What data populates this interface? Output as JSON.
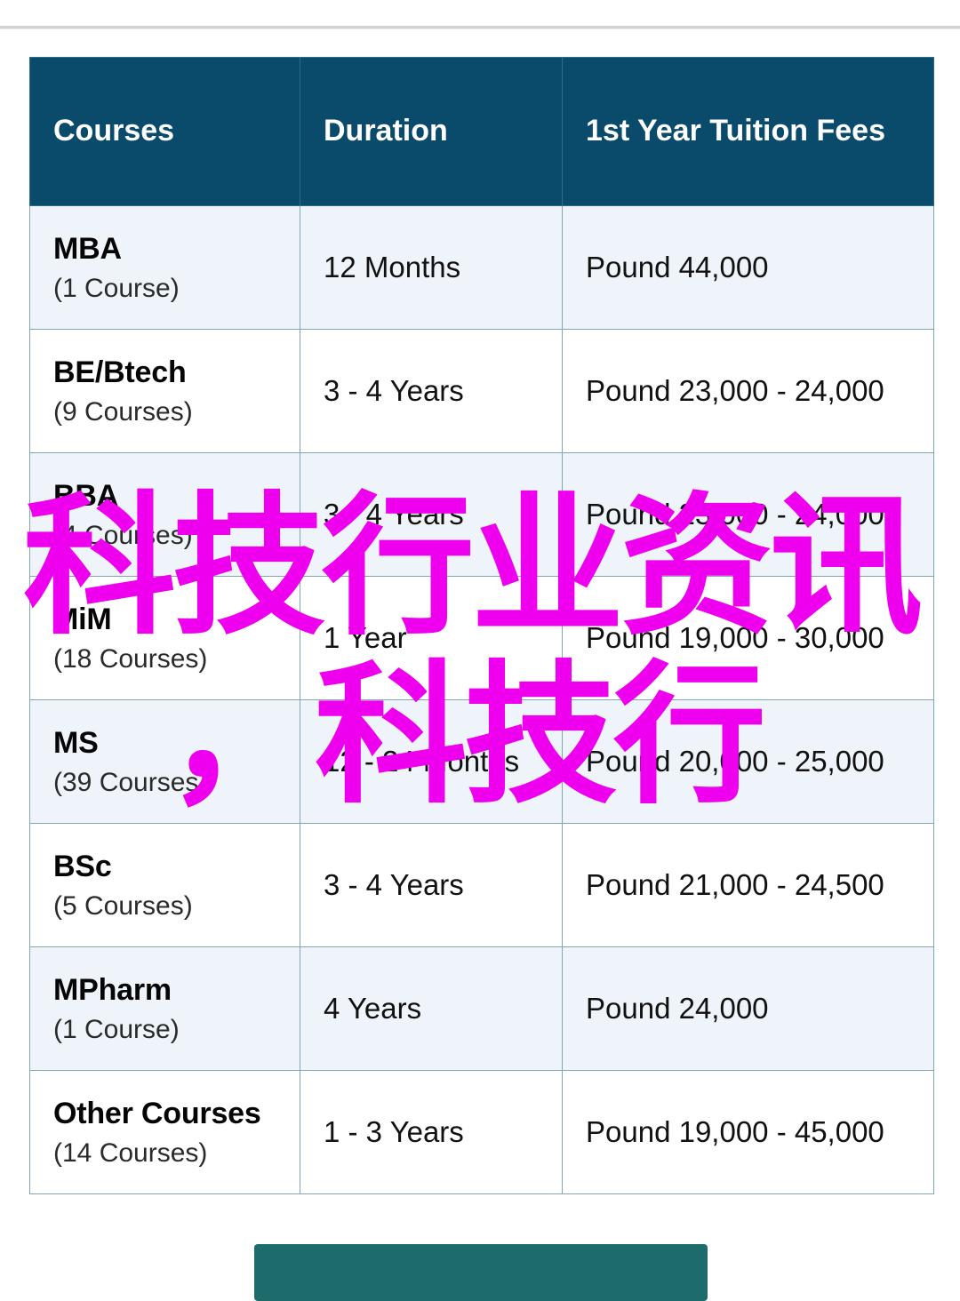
{
  "colors": {
    "header_bg": "#0a4a6b",
    "header_text": "#ffffff",
    "row_alt_bg": "#eff4fa",
    "row_bg": "#ffffff",
    "border": "#7fa6b1",
    "watermark": "#ee00ee",
    "bottom_bar": "#1d6b6b"
  },
  "table": {
    "headers": [
      "Courses",
      "Duration",
      "1st Year Tuition Fees"
    ],
    "rows": [
      {
        "course": "MBA",
        "count": "(1 Course)",
        "duration": "12 Months",
        "fees": "Pound 44,000"
      },
      {
        "course": "BE/Btech",
        "count": "(9 Courses)",
        "duration": "3 - 4 Years",
        "fees": "Pound 23,000 - 24,000"
      },
      {
        "course": "BBA",
        "count": "(4 Courses)",
        "duration": "3 - 4 Years",
        "fees": "Pound 23,000 - 24,000"
      },
      {
        "course": "MiM",
        "count": "(18 Courses)",
        "duration": "1 Year",
        "fees": "Pound 19,000 - 30,000"
      },
      {
        "course": "MS",
        "count": "(39 Courses)",
        "duration": "12 - 24 Months",
        "fees": "Pound 20,000 - 25,000"
      },
      {
        "course": "BSc",
        "count": "(5 Courses)",
        "duration": "3 - 4 Years",
        "fees": "Pound 21,000 - 24,500"
      },
      {
        "course": "MPharm",
        "count": "(1 Course)",
        "duration": "4 Years",
        "fees": "Pound 24,000"
      },
      {
        "course": "Other Courses",
        "count": "(14 Courses)",
        "duration": "1 - 3 Years",
        "fees": "Pound 19,000 - 45,000"
      }
    ]
  },
  "watermark": {
    "line1": "科技行业资讯",
    "line2": "，科技行"
  }
}
